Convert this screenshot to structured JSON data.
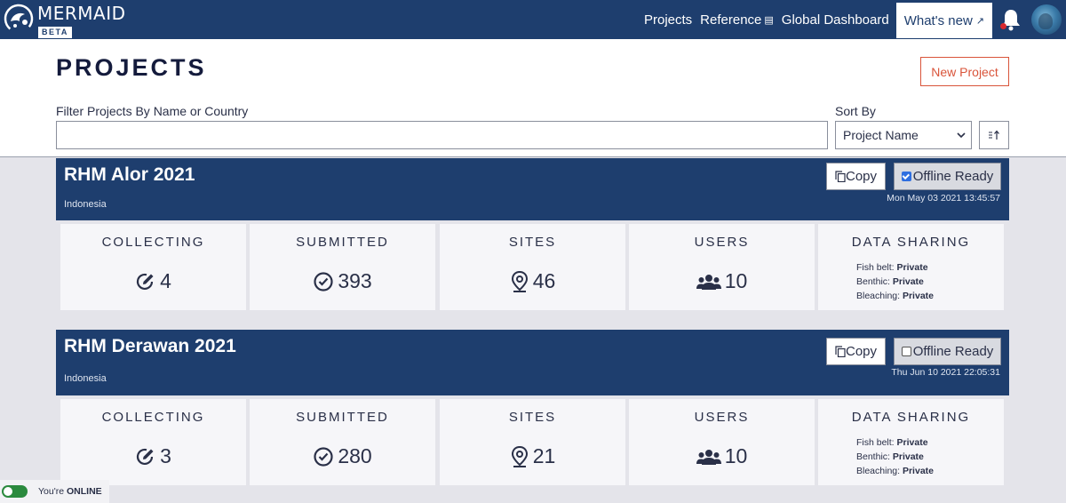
{
  "nav": {
    "brand": "MERMAID",
    "badge": "BETA",
    "links": [
      {
        "label": "Projects"
      },
      {
        "label": "Reference"
      },
      {
        "label": "Global Dashboard"
      }
    ],
    "whats_new": "What's new"
  },
  "page": {
    "title": "PROJECTS",
    "new_project": "New Project",
    "filter_label": "Filter Projects By Name or Country",
    "filter_value": "",
    "sort_label": "Sort By",
    "sort_value": "Project Name"
  },
  "projects": [
    {
      "name": "RHM Alor 2021",
      "country": "Indonesia",
      "copy_label": "Copy",
      "offline_label": "Offline Ready",
      "offline_checked": true,
      "updated": "Mon May 03 2021 13:45:57",
      "stats": {
        "collecting": {
          "label": "COLLECTING",
          "value": "4"
        },
        "submitted": {
          "label": "SUBMITTED",
          "value": "393"
        },
        "sites": {
          "label": "SITES",
          "value": "46"
        },
        "users": {
          "label": "USERS",
          "value": "10"
        }
      },
      "sharing": {
        "label": "DATA SHARING",
        "items": [
          {
            "name": "Fish belt:",
            "value": "Private"
          },
          {
            "name": "Benthic:",
            "value": "Private"
          },
          {
            "name": "Bleaching:",
            "value": "Private"
          }
        ]
      }
    },
    {
      "name": "RHM Derawan 2021",
      "country": "Indonesia",
      "copy_label": "Copy",
      "offline_label": "Offline Ready",
      "offline_checked": false,
      "updated": "Thu Jun 10 2021 22:05:31",
      "stats": {
        "collecting": {
          "label": "COLLECTING",
          "value": "3"
        },
        "submitted": {
          "label": "SUBMITTED",
          "value": "280"
        },
        "sites": {
          "label": "SITES",
          "value": "21"
        },
        "users": {
          "label": "USERS",
          "value": "10"
        }
      },
      "sharing": {
        "label": "DATA SHARING",
        "items": [
          {
            "name": "Fish belt:",
            "value": "Private"
          },
          {
            "name": "Benthic:",
            "value": "Private"
          },
          {
            "name": "Bleaching:",
            "value": "Private"
          }
        ]
      }
    }
  ],
  "status": {
    "prefix": "You're",
    "state": "ONLINE"
  }
}
